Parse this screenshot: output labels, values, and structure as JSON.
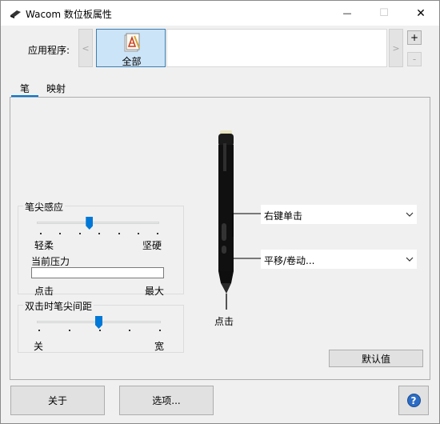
{
  "window": {
    "title": "Wacom 数位板属性",
    "minimize_glyph": "—",
    "maximize_glyph": "☐",
    "close_glyph": "✕"
  },
  "applications": {
    "label": "应用程序:",
    "scroll_left": "<",
    "scroll_right": ">",
    "add_glyph": "+",
    "remove_glyph": "-",
    "items": [
      {
        "label": "全部",
        "icon": "all-apps-icon",
        "selected": true
      }
    ]
  },
  "tabs": [
    {
      "label": "笔",
      "active": true
    },
    {
      "label": "映射",
      "active": false
    }
  ],
  "tip_feel": {
    "title": "笔尖感应",
    "min_label": "轻柔",
    "max_label": "坚硬",
    "slider_level": 0.43,
    "current_pressure_label": "当前压力",
    "pressure_min_label": "点击",
    "pressure_max_label": "最大",
    "current_pressure_fraction": 0
  },
  "double_click_distance": {
    "title": "双击时笔尖间距",
    "min_label": "关",
    "max_label": "宽",
    "slider_level": 0.5
  },
  "pen_buttons": {
    "upper": {
      "value": "右键单击"
    },
    "lower": {
      "value": "平移/卷动..."
    },
    "tip_label": "点击"
  },
  "buttons": {
    "default": "默认值",
    "about": "关于",
    "options": "选项...",
    "help_glyph": "?"
  },
  "colors": {
    "accent": "#0078d7",
    "selected_tile": "#cce4f7",
    "help": "#2c6cc4"
  }
}
